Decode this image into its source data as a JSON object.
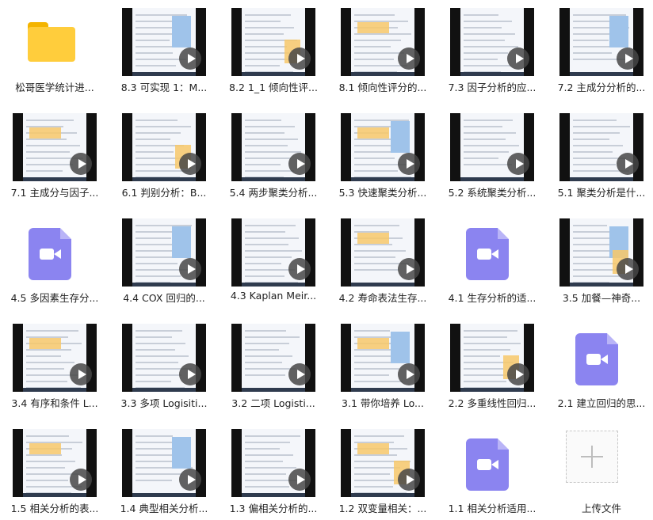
{
  "items": [
    {
      "label": "松哥医学统计进...",
      "type": "folder",
      "icon": "folder-icon"
    },
    {
      "label": "8.3 可实现 1：M...",
      "type": "video"
    },
    {
      "label": "8.2 1_1 倾向性评...",
      "type": "video"
    },
    {
      "label": "8.1 倾向性评分的...",
      "type": "video"
    },
    {
      "label": "7.3 因子分析的应...",
      "type": "video"
    },
    {
      "label": "7.2 主成分分析的...",
      "type": "video"
    },
    {
      "label": "7.1 主成分与因子...",
      "type": "video"
    },
    {
      "label": "6.1 判别分析：B...",
      "type": "video"
    },
    {
      "label": "5.4 两步聚类分析...",
      "type": "video"
    },
    {
      "label": "5.3 快速聚类分析...",
      "type": "video"
    },
    {
      "label": "5.2 系统聚类分析...",
      "type": "video"
    },
    {
      "label": "5.1 聚类分析是什...",
      "type": "video"
    },
    {
      "label": "4.5 多因素生存分...",
      "type": "file",
      "icon": "video-file-icon"
    },
    {
      "label": "4.4 COX 回归的...",
      "type": "video"
    },
    {
      "label": "4.3 Kaplan Meir...",
      "type": "video"
    },
    {
      "label": "4.2 寿命表法生存...",
      "type": "video"
    },
    {
      "label": "4.1 生存分析的适...",
      "type": "file",
      "icon": "video-file-icon"
    },
    {
      "label": "3.5 加餐—神奇...",
      "type": "video"
    },
    {
      "label": "3.4 有序和条件 L...",
      "type": "video"
    },
    {
      "label": "3.3 多项 Logisiti...",
      "type": "video"
    },
    {
      "label": "3.2 二项 Logisti...",
      "type": "video"
    },
    {
      "label": "3.1 带你培养 Lo...",
      "type": "video"
    },
    {
      "label": "2.2 多重线性回归...",
      "type": "video"
    },
    {
      "label": "2.1 建立回归的思...",
      "type": "file",
      "icon": "video-file-icon"
    },
    {
      "label": "1.5 相关分析的表...",
      "type": "video"
    },
    {
      "label": "1.4 典型相关分析...",
      "type": "video"
    },
    {
      "label": "1.3 偏相关分析的...",
      "type": "video"
    },
    {
      "label": "1.2 双变量相关：...",
      "type": "video"
    },
    {
      "label": "1.1 相关分析适用...",
      "type": "file",
      "icon": "video-file-icon"
    },
    {
      "label": "上传文件",
      "type": "upload",
      "icon": "plus-icon"
    }
  ],
  "colors": {
    "folder": "#ffcd3c",
    "video_file": "#8b84f0",
    "play_overlay": "#464646"
  }
}
